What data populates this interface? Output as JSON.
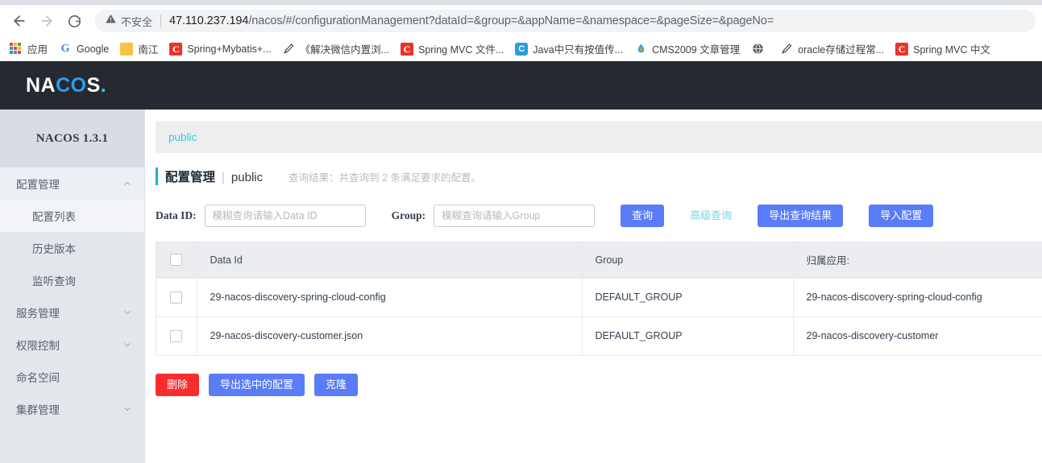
{
  "browser": {
    "back_icon": "arrow-left-icon",
    "forward_icon": "arrow-right-icon",
    "reload_icon": "reload-icon",
    "security_label": "不安全",
    "url_host": "47.110.237.194",
    "url_path": "/nacos/#/configurationManagement?dataId=&group=&appName=&namespace=&pageSize=&pageNo=",
    "bookmarks": [
      {
        "label": "应用",
        "icon": "apps-grid-icon"
      },
      {
        "label": "Google",
        "icon": "google-g-icon"
      },
      {
        "label": "南江",
        "icon": "folder-icon"
      },
      {
        "label": "Spring+Mybatis+...",
        "icon": "csdn-c-icon"
      },
      {
        "label": "《解决微信内置浏...",
        "icon": "doc-pen-icon"
      },
      {
        "label": "Spring MVC 文件...",
        "icon": "csdn-c-icon"
      },
      {
        "label": "Java中只有按值传...",
        "icon": "java-blog-icon"
      },
      {
        "label": "CMS2009 文章管理",
        "icon": "cms-flame-icon"
      },
      {
        "label": "",
        "icon": "globe-icon"
      },
      {
        "label": "oracle存储过程常...",
        "icon": "doc-pen-icon"
      },
      {
        "label": "Spring MVC 中文",
        "icon": "csdn-c-icon"
      }
    ]
  },
  "app": {
    "logo": {
      "part_white_1": "NA",
      "part_blue": "CO",
      "part_white_2": "S",
      "dot": "."
    },
    "version": "NACOS 1.3.1"
  },
  "sidebar": {
    "items": [
      {
        "label": "配置管理",
        "level": "parent",
        "state": "open",
        "chevron": "chevron-up-icon",
        "name": "sidebar-item-config-management"
      },
      {
        "label": "配置列表",
        "level": "sub",
        "state": "active",
        "chevron": "",
        "name": "sidebar-item-config-list"
      },
      {
        "label": "历史版本",
        "level": "sub",
        "state": "",
        "chevron": "",
        "name": "sidebar-item-history-versions"
      },
      {
        "label": "监听查询",
        "level": "sub",
        "state": "",
        "chevron": "",
        "name": "sidebar-item-listener-query"
      },
      {
        "label": "服务管理",
        "level": "parent",
        "state": "",
        "chevron": "chevron-down-icon",
        "name": "sidebar-item-service-management"
      },
      {
        "label": "权限控制",
        "level": "parent",
        "state": "",
        "chevron": "chevron-down-icon",
        "name": "sidebar-item-permission-control"
      },
      {
        "label": "命名空间",
        "level": "parent",
        "state": "",
        "chevron": "",
        "name": "sidebar-item-namespace"
      },
      {
        "label": "集群管理",
        "level": "parent",
        "state": "",
        "chevron": "chevron-down-icon",
        "name": "sidebar-item-cluster-management"
      }
    ]
  },
  "main": {
    "breadcrumb": "public",
    "title": "配置管理",
    "title_separator": "|",
    "namespace": "public",
    "result_note": "查询结果：共查询到 2 条满足要求的配置。",
    "search": {
      "dataid_label": "Data ID:",
      "dataid_value": "",
      "dataid_placeholder": "模糊查询请输入Data ID",
      "group_label": "Group:",
      "group_value": "",
      "group_placeholder": "模糊查询请输入Group",
      "query_button": "查询",
      "advanced_query_link": "高级查询",
      "export_button": "导出查询结果",
      "import_button": "导入配置"
    },
    "table": {
      "columns": [
        "Data Id",
        "Group",
        "归属应用:"
      ],
      "rows": [
        {
          "data_id": "29-nacos-discovery-spring-cloud-config",
          "group": "DEFAULT_GROUP",
          "app": "29-nacos-discovery-spring-cloud-config"
        },
        {
          "data_id": "29-nacos-discovery-customer.json",
          "group": "DEFAULT_GROUP",
          "app": "29-nacos-discovery-customer"
        }
      ]
    },
    "bottom_actions": {
      "delete_button": "删除",
      "export_selected_button": "导出选中的配置",
      "clone_button": "克隆"
    }
  },
  "colors": {
    "accent_blue": "#5b7cf7",
    "danger_red": "#f82d2d",
    "link_cyan": "#3bc7dd",
    "header_dark": "#242a30",
    "sidebar_bg": "#e3e6eb"
  }
}
